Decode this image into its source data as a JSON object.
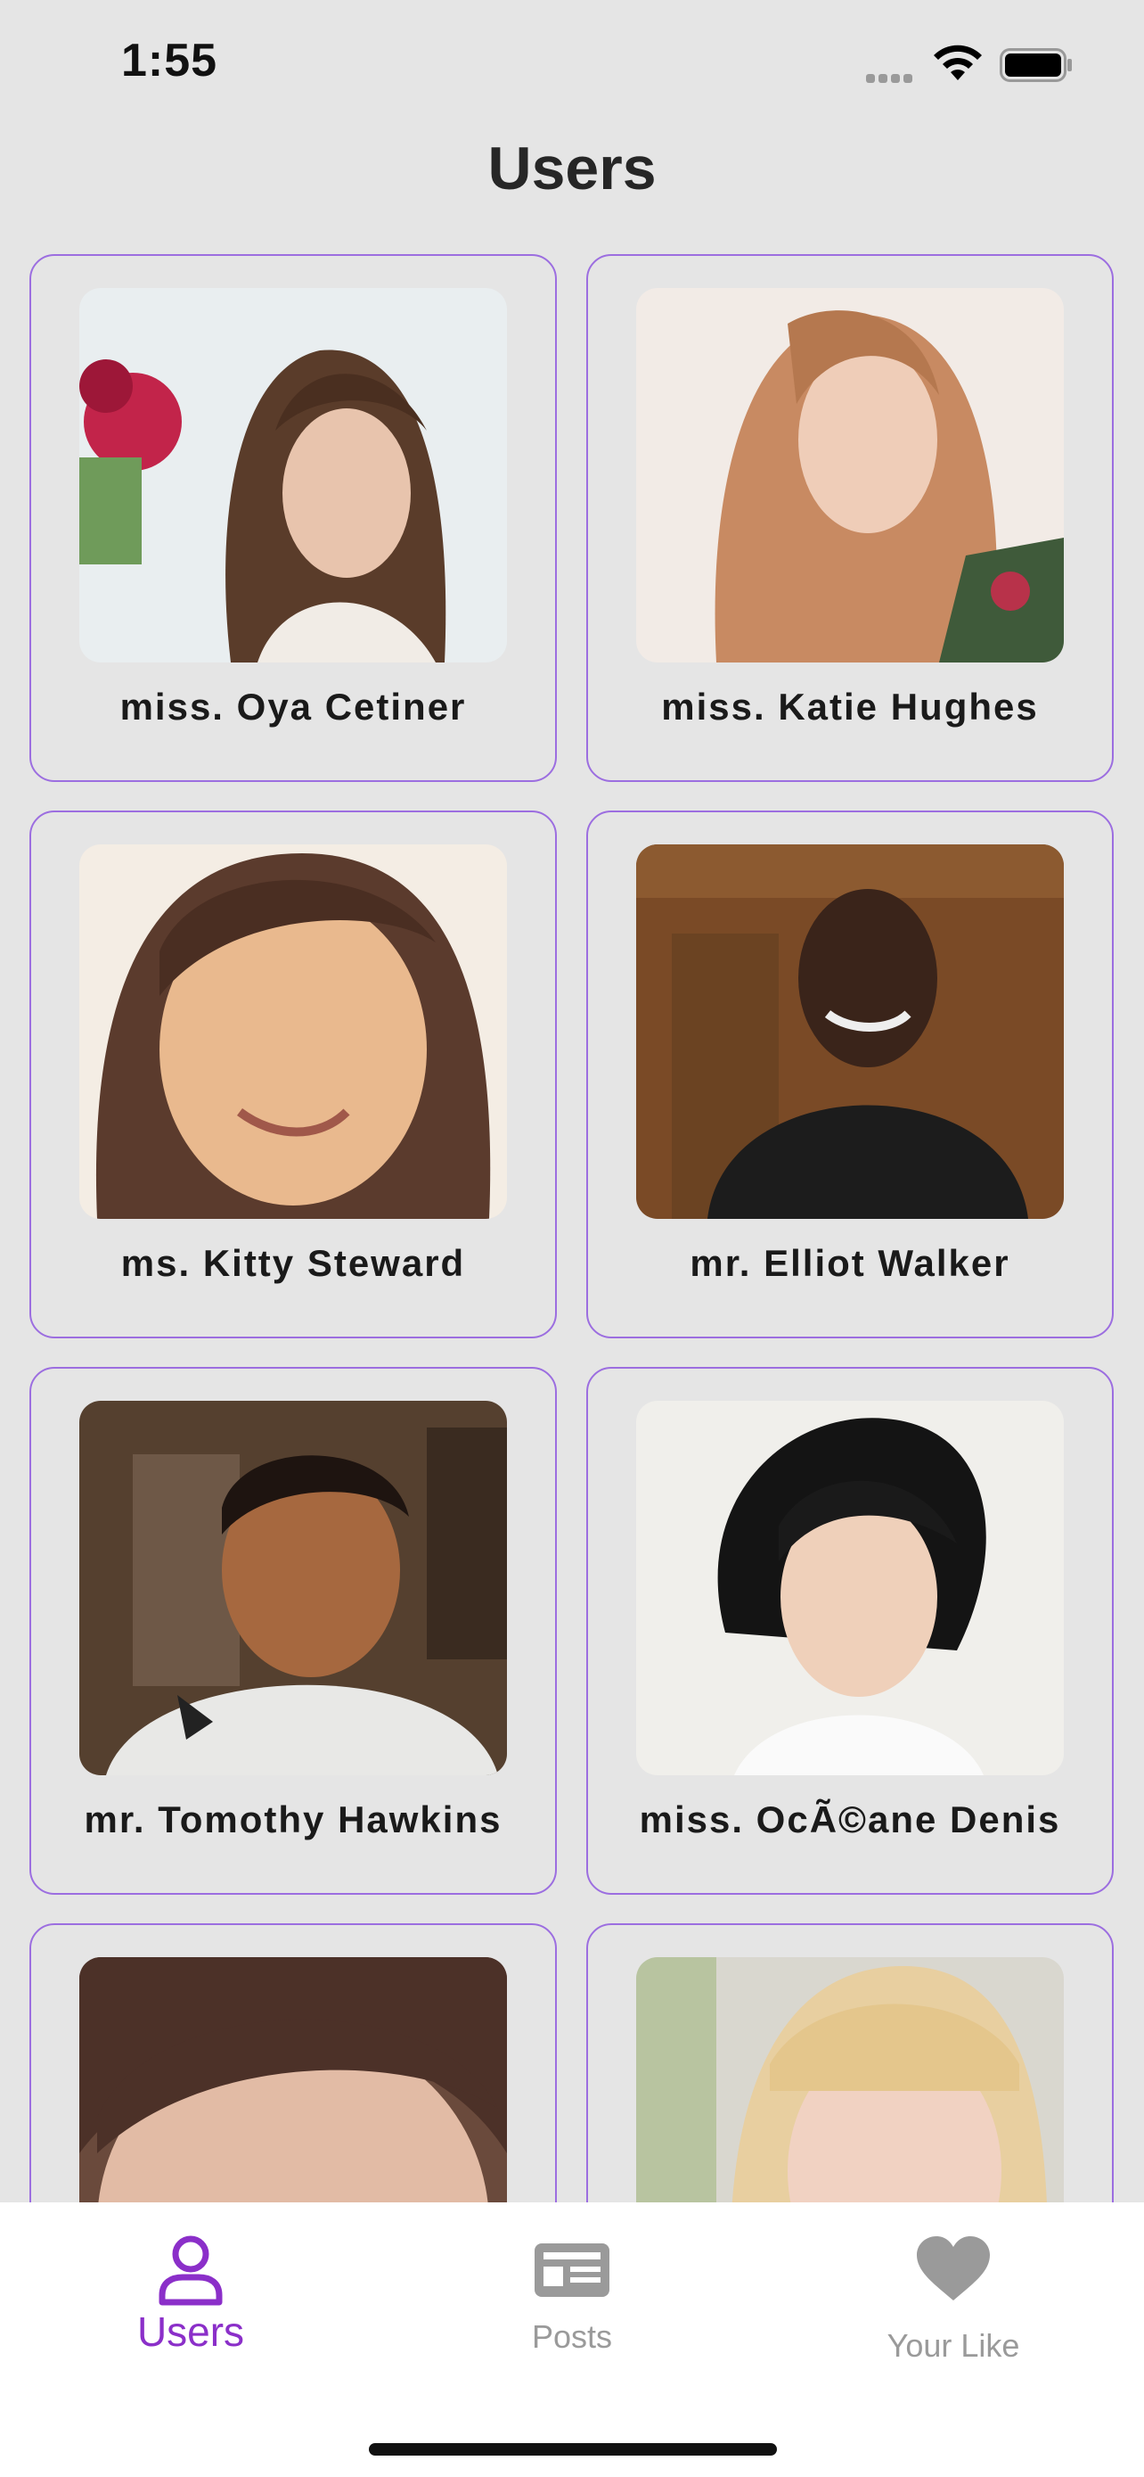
{
  "status_bar": {
    "time": "1:55"
  },
  "header": {
    "title": "Users"
  },
  "users": [
    {
      "name": "miss. Oya Cetiner"
    },
    {
      "name": "miss. Katie Hughes"
    },
    {
      "name": "ms. Kitty Steward"
    },
    {
      "name": "mr. Elliot Walker"
    },
    {
      "name": "mr. Tomothy Hawkins"
    },
    {
      "name": "miss. OcÃ©ane Denis"
    },
    {
      "name": ""
    },
    {
      "name": ""
    }
  ],
  "tab_bar": {
    "tabs": [
      {
        "label": "Users",
        "icon": "user-icon",
        "active": true
      },
      {
        "label": "Posts",
        "icon": "newspaper-icon",
        "active": false
      },
      {
        "label": "Your Like",
        "icon": "heart-icon",
        "active": false
      }
    ]
  },
  "colors": {
    "accent": "#8b2fc9",
    "card_border": "#9c6ee0",
    "inactive_tab": "#9a9a9a",
    "background": "#e5e5e5"
  }
}
